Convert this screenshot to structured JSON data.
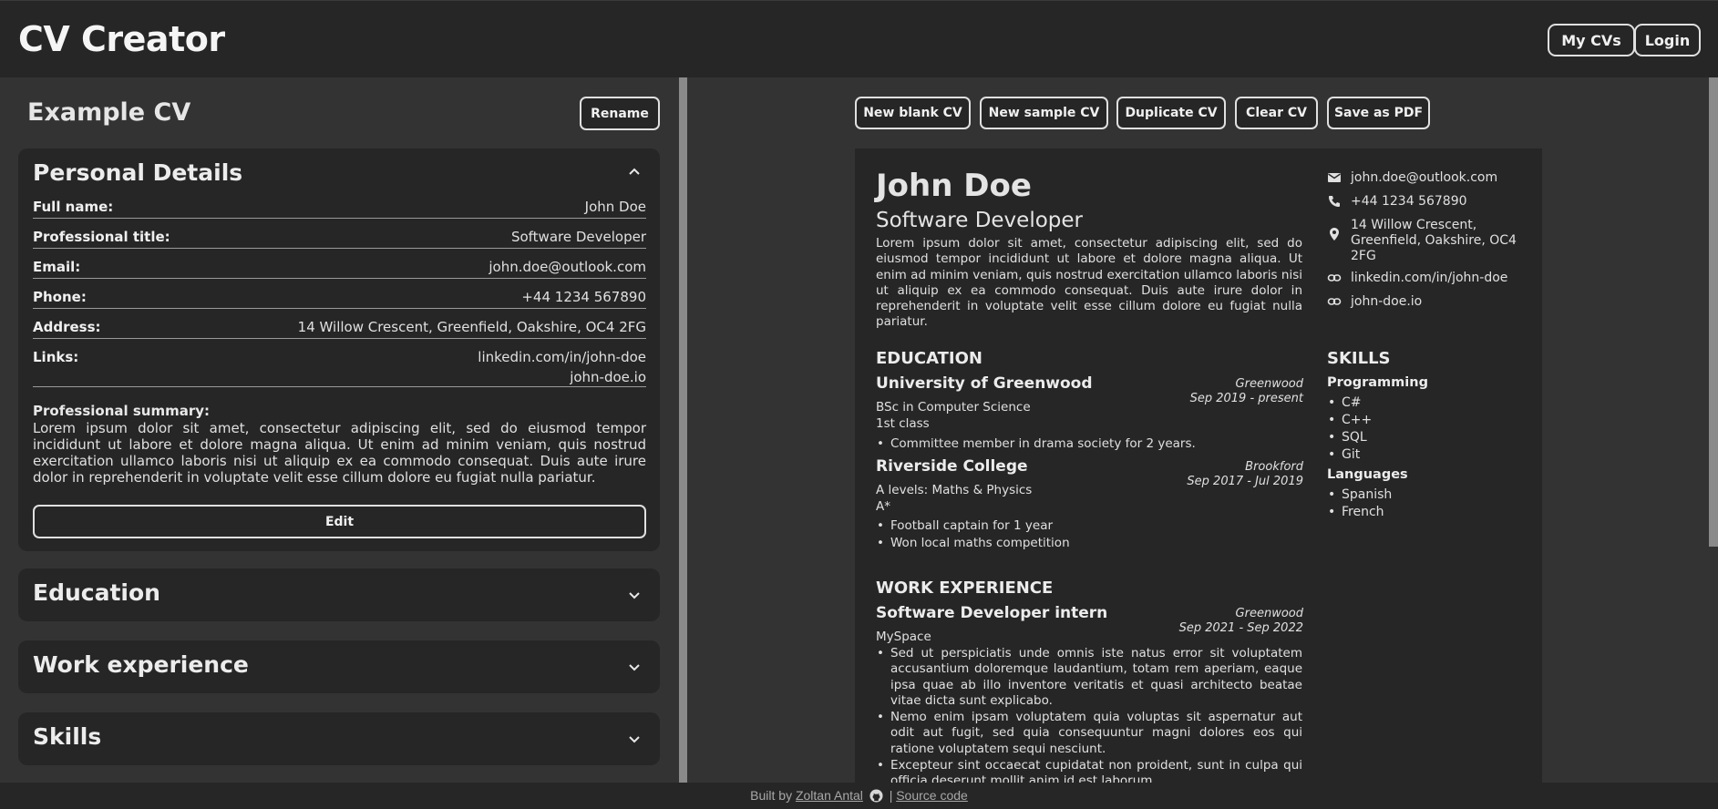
{
  "header": {
    "app_title": "CV Creator",
    "my_cvs_label": "My CVs",
    "login_label": "Login"
  },
  "editor": {
    "cv_name": "Example CV",
    "rename_label": "Rename",
    "personal": {
      "title": "Personal Details",
      "fields": [
        {
          "label": "Full name:",
          "value": "John Doe"
        },
        {
          "label": "Professional title:",
          "value": "Software Developer"
        },
        {
          "label": "Email:",
          "value": "john.doe@outlook.com"
        },
        {
          "label": "Phone:",
          "value": "+44 1234 567890"
        },
        {
          "label": "Address:",
          "value": "14 Willow Crescent, Greenfield, Oakshire, OC4 2FG"
        }
      ],
      "links_label": "Links:",
      "links": [
        "linkedin.com/in/john-doe",
        "john-doe.io"
      ],
      "summary_label": "Professional summary:",
      "summary": "Lorem ipsum dolor sit amet, consectetur adipiscing elit, sed do eiusmod tempor incididunt ut labore et dolore magna aliqua. Ut enim ad minim veniam, quis nostrud exercitation ullamco laboris nisi ut aliquip ex ea commodo consequat. Duis aute irure dolor in reprehenderit in voluptate velit esse cillum dolore eu fugiat nulla pariatur.",
      "edit_label": "Edit"
    },
    "sections": [
      "Education",
      "Work experience",
      "Skills"
    ]
  },
  "toolbar": {
    "buttons": [
      "New blank CV",
      "New sample CV",
      "Duplicate CV",
      "Clear CV",
      "Save as PDF"
    ]
  },
  "preview": {
    "name": "John Doe",
    "title": "Software Developer",
    "summary": "Lorem ipsum dolor sit amet, consectetur adipiscing elit, sed do eiusmod tempor incididunt ut labore et dolore magna aliqua. Ut enim ad minim veniam, quis nostrud exercitation ullamco laboris nisi ut aliquip ex ea commodo consequat. Duis aute irure dolor in reprehenderit in voluptate velit esse cillum dolore eu fugiat nulla pariatur.",
    "contact": {
      "email": "john.doe@outlook.com",
      "phone": "+44 1234 567890",
      "address": "14 Willow Crescent, Greenfield, Oakshire, OC4 2FG",
      "links": [
        "linkedin.com/in/john-doe",
        "john-doe.io"
      ]
    },
    "education_heading": "EDUCATION",
    "education": [
      {
        "school": "University of Greenwood",
        "location": "Greenwood",
        "dates": "Sep 2019 - present",
        "degree": "BSc in Computer Science",
        "grade": "1st class",
        "bullets": [
          "Committee member in drama society for 2 years."
        ]
      },
      {
        "school": "Riverside College",
        "location": "Brookford",
        "dates": "Sep 2017 - Jul 2019",
        "degree": "A levels: Maths & Physics",
        "grade": "A*",
        "bullets": [
          "Football captain for 1 year",
          "Won local maths competition"
        ]
      }
    ],
    "work_heading": "WORK EXPERIENCE",
    "work": [
      {
        "role": "Software Developer intern",
        "location": "Greenwood",
        "dates": "Sep 2021 - Sep 2022",
        "company": "MySpace",
        "bullets": [
          "Sed ut perspiciatis unde omnis iste natus error sit voluptatem accusantium doloremque laudantium, totam rem aperiam, eaque ipsa quae ab illo inventore veritatis et quasi architecto beatae vitae dicta sunt explicabo.",
          "Nemo enim ipsam voluptatem quia voluptas sit aspernatur aut odit aut fugit, sed quia consequuntur magni dolores eos qui ratione voluptatem sequi nesciunt.",
          "Excepteur sint occaecat cupidatat non proident, sunt in culpa qui officia deserunt mollit anim id est laborum."
        ]
      }
    ],
    "skills_heading": "SKILLS",
    "skills": [
      {
        "name": "Programming",
        "items": [
          "C#",
          "C++",
          "SQL",
          "Git"
        ]
      },
      {
        "name": "Languages",
        "items": [
          "Spanish",
          "French"
        ]
      }
    ]
  },
  "footer": {
    "built_by": "Built by",
    "author": "Zoltan Antal",
    "separator": "|",
    "source": "Source code"
  }
}
